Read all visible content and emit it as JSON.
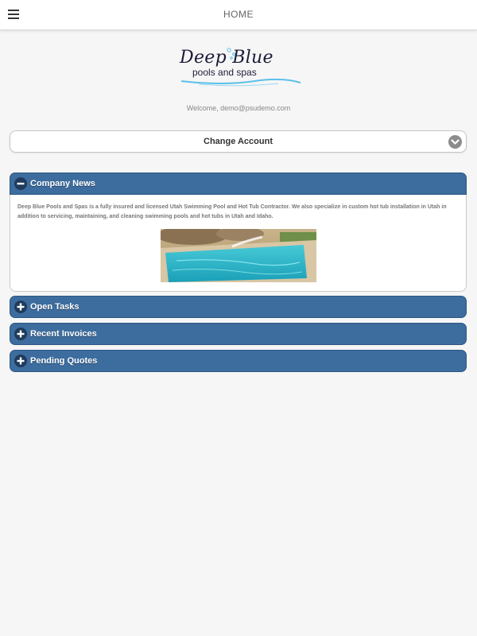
{
  "header": {
    "title": "HOME",
    "menu_icon": "hamburger-menu-icon"
  },
  "logo": {
    "title": "Deep Blue",
    "subtitle": "pools and spas",
    "colors": {
      "text": "#1c1c3a",
      "wave": "#5bc0e8"
    }
  },
  "welcome": "Welcome, demo@psudemo.com",
  "change_account": {
    "label": "Change Account",
    "icon": "chevron-down-icon"
  },
  "sections": {
    "company_news": {
      "label": "Company News",
      "expanded": true,
      "icon": "minus-icon",
      "text": "Deep Blue Pools and Spas is a fully insured and licensed Utah Swimming Pool and Hot Tub Contractor. We also specialize in custom hot tub installation in Utah in addition to servicing, maintaining, and cleaning swimming pools and hot tubs in Utah and Idaho.",
      "image": "swimming-pool-photo"
    },
    "open_tasks": {
      "label": "Open Tasks",
      "expanded": false,
      "icon": "plus-icon"
    },
    "recent_invoices": {
      "label": "Recent Invoices",
      "expanded": false,
      "icon": "plus-icon"
    },
    "pending_quotes": {
      "label": "Pending Quotes",
      "expanded": false,
      "icon": "plus-icon"
    }
  },
  "colors": {
    "section_header": "#3d6d9e",
    "section_border": "#2d5682",
    "background": "#f6f6f6"
  }
}
